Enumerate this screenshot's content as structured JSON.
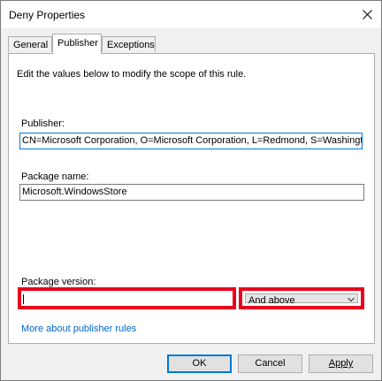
{
  "window": {
    "title": "Deny Properties",
    "close_icon": "close-icon"
  },
  "tabs": [
    {
      "label": "General",
      "active": false
    },
    {
      "label": "Publisher",
      "active": true
    },
    {
      "label": "Exceptions",
      "active": false
    }
  ],
  "publisher_tab": {
    "description": "Edit the values below to modify the scope of this rule.",
    "publisher": {
      "label": "Publisher:",
      "value": "CN=Microsoft Corporation, O=Microsoft Corporation, L=Redmond, S=Washington, C=US"
    },
    "package_name": {
      "label": "Package name:",
      "value": "Microsoft.WindowsStore"
    },
    "package_version": {
      "label": "Package version:",
      "value": "",
      "range_selected": "And above"
    },
    "link": "More about publisher rules",
    "highlight_color": "#e8001c"
  },
  "buttons": {
    "ok": "OK",
    "cancel": "Cancel",
    "apply": "Apply"
  }
}
